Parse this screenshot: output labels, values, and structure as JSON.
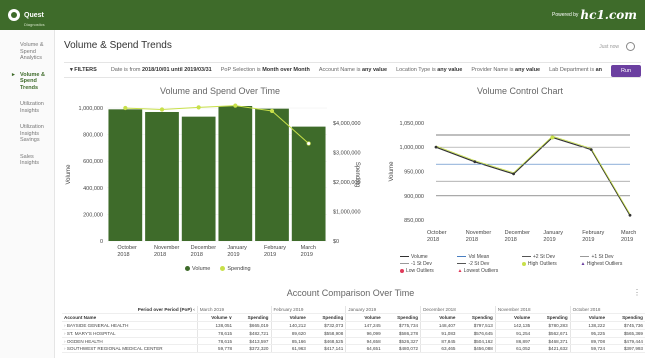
{
  "brand": {
    "name": "Quest",
    "sub": "Diagnostics",
    "powered_prefix": "Powered by",
    "powered_logo": "hc1.com"
  },
  "sidebar": {
    "items": [
      {
        "label": "Volume & Spend Analytics",
        "active": false
      },
      {
        "label": "Volume & Spend Trends",
        "active": true
      },
      {
        "label": "Utilization Insights",
        "active": false
      },
      {
        "label": "Utilization Insights Savings",
        "active": false
      },
      {
        "label": "Sales Insights",
        "active": false
      }
    ]
  },
  "header": {
    "title": "Volume & Spend Trends",
    "status": "Just now",
    "settings_icon": "gear-icon"
  },
  "filters": {
    "label": "FILTERS",
    "items": [
      {
        "text": "Date is from ",
        "value": "2018/10/01 until 2019/03/31"
      },
      {
        "text": "PoP Selection is ",
        "value": "Month over Month"
      },
      {
        "text": "Account Name is ",
        "value": "any value"
      },
      {
        "text": "Location Type is ",
        "value": "any value"
      },
      {
        "text": "Provider Name is ",
        "value": "any value"
      },
      {
        "text": "Lab Department is ",
        "value": "an"
      }
    ],
    "run_label": "Run"
  },
  "chart_data": [
    {
      "type": "bar",
      "title": "Volume and Spend Over Time",
      "categories": [
        "October 2018",
        "November 2018",
        "December 2018",
        "January 2019",
        "February 2019",
        "March 2019"
      ],
      "ylabel": "Volume",
      "y2label": "Spending",
      "ylim": [
        0,
        1000000
      ],
      "y2lim": [
        0,
        4500000
      ],
      "yticks": [
        "0",
        "200,000",
        "400,000",
        "600,000",
        "800,000",
        "1,000,000"
      ],
      "y2ticks": [
        "$0",
        "$1,000,000",
        "$2,000,000",
        "$3,000,000",
        "$4,000,000"
      ],
      "series": [
        {
          "name": "Volume",
          "type": "bar",
          "color": "#3e6b2a",
          "values": [
            990000,
            970000,
            935000,
            1015000,
            995000,
            860000
          ]
        },
        {
          "name": "Spending",
          "type": "line",
          "color": "#c8e04a",
          "values": [
            4500000,
            4450000,
            4520000,
            4580000,
            4400000,
            3300000
          ]
        }
      ],
      "legend": "bottom"
    },
    {
      "type": "line",
      "title": "Volume Control Chart",
      "categories": [
        "October 2018",
        "November 2018",
        "December 2018",
        "January 2019",
        "February 2019",
        "March 2019"
      ],
      "ylabel": "Volume",
      "ylim": [
        840000,
        1060000
      ],
      "yticks": [
        "850,000",
        "900,000",
        "950,000",
        "1,000,000",
        "1,050,000"
      ],
      "series": [
        {
          "name": "Volume",
          "color": "#333333",
          "values": [
            1000000,
            970000,
            945000,
            1020000,
            995000,
            860000
          ]
        },
        {
          "name": "Vol Mean",
          "color": "#4a7fc1",
          "values": [
            965000,
            965000,
            965000,
            965000,
            965000,
            965000
          ]
        },
        {
          "name": "+2 St Dev",
          "color": "#555555",
          "values": [
            1025000,
            1025000,
            1025000,
            1025000,
            1025000,
            1025000
          ]
        },
        {
          "name": "+1 St Dev",
          "color": "#999999",
          "values": [
            1000000,
            1000000,
            1000000,
            1000000,
            1000000,
            1000000
          ]
        },
        {
          "name": "-1 St Dev",
          "color": "#999999",
          "values": [
            930000,
            930000,
            930000,
            930000,
            930000,
            930000
          ]
        },
        {
          "name": "-2 St Dev",
          "color": "#555555",
          "values": [
            900000,
            900000,
            900000,
            900000,
            900000,
            900000
          ]
        }
      ],
      "legend_items": [
        {
          "name": "Volume",
          "color": "#333333",
          "marker": "line"
        },
        {
          "name": "Vol Mean",
          "color": "#4a7fc1",
          "marker": "line"
        },
        {
          "name": "+2 St Dev",
          "color": "#555555",
          "marker": "line"
        },
        {
          "name": "+1 St Dev",
          "color": "#999999",
          "marker": "line"
        },
        {
          "name": "-1 St Dev",
          "color": "#999999",
          "marker": "line"
        },
        {
          "name": "-2 St Dev",
          "color": "#555555",
          "marker": "line"
        },
        {
          "name": "High Outliers",
          "color": "#c8e04a",
          "marker": "dot"
        },
        {
          "name": "Highest Outliers",
          "color": "#6b3fa0",
          "marker": "triangle"
        },
        {
          "name": "Low Outliers",
          "color": "#e03a5a",
          "marker": "dot"
        },
        {
          "name": "Lowest Outliers",
          "color": "#e03a5a",
          "marker": "triangle"
        }
      ]
    }
  ],
  "table": {
    "title": "Account Comparison Over Time",
    "pop_label": "Period over Period (PoP)",
    "periods": [
      "March 2019",
      "February 2019",
      "January 2019",
      "December 2018",
      "November 2018",
      "October 2018"
    ],
    "account_header": "Account Name",
    "col_volume": "Volume",
    "col_spending": "Spending",
    "rows": [
      {
        "name": "BAYSIDE GENERAL HEALTH",
        "values": [
          "138,051",
          "$665,019",
          "140,212",
          "$732,073",
          "147,245",
          "$775,734",
          "148,407",
          "$797,513",
          "142,135",
          "$780,283",
          "138,222",
          "$745,736"
        ]
      },
      {
        "name": "ST. MARY'S HOSPITAL",
        "values": [
          "78,615",
          "$482,721",
          "89,620",
          "$558,908",
          "96,099",
          "$586,278",
          "91,083",
          "$576,645",
          "91,254",
          "$562,671",
          "95,225",
          "$565,369"
        ]
      },
      {
        "name": "OGDEN HEALTH",
        "values": [
          "78,615",
          "$413,597",
          "85,166",
          "$468,525",
          "94,658",
          "$526,327",
          "87,845",
          "$504,162",
          "86,897",
          "$468,371",
          "89,708",
          "$479,444"
        ]
      },
      {
        "name": "SOUTHWEST REGIONAL MEDICAL CENTER",
        "values": [
          "59,778",
          "$372,320",
          "61,963",
          "$417,141",
          "64,651",
          "$480,072",
          "63,465",
          "$456,088",
          "61,052",
          "$421,632",
          "59,724",
          "$397,993"
        ]
      }
    ]
  }
}
